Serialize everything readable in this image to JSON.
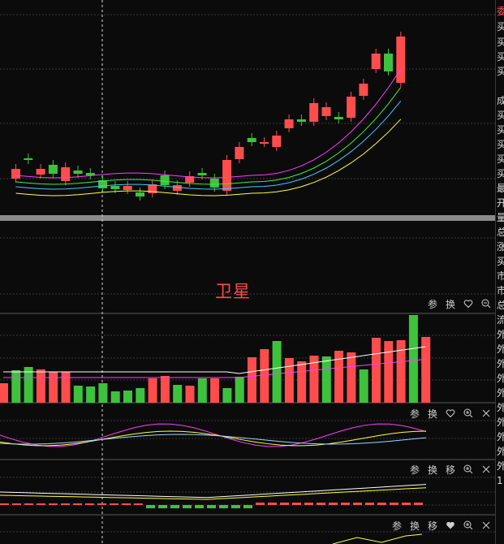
{
  "satellite_label": "卫星",
  "toolbars": [
    {
      "buttons": [
        {
          "name": "param-button",
          "label": "参"
        },
        {
          "name": "switch-button",
          "label": "换"
        },
        {
          "name": "favorite-button",
          "icon": "heart-outline-icon"
        },
        {
          "name": "zoom-out-button",
          "icon": "zoom-out-icon"
        }
      ]
    },
    {
      "buttons": [
        {
          "name": "param-button",
          "label": "参"
        },
        {
          "name": "switch-button",
          "label": "换"
        },
        {
          "name": "favorite-button",
          "icon": "heart-outline-icon"
        },
        {
          "name": "zoom-in-button",
          "icon": "zoom-in-icon"
        },
        {
          "name": "close-button",
          "icon": "close-icon"
        }
      ]
    },
    {
      "buttons": [
        {
          "name": "param-button",
          "label": "参"
        },
        {
          "name": "switch-button",
          "label": "换"
        },
        {
          "name": "move-button",
          "label": "移"
        },
        {
          "name": "zoom-in-button",
          "icon": "zoom-in-icon"
        },
        {
          "name": "close-button",
          "icon": "close-icon"
        }
      ]
    },
    {
      "buttons": [
        {
          "name": "param-button",
          "label": "参"
        },
        {
          "name": "switch-button",
          "label": "换"
        },
        {
          "name": "move-button",
          "label": "移"
        },
        {
          "name": "favorite-button",
          "icon": "heart-filled-icon"
        },
        {
          "name": "zoom-in-button",
          "icon": "zoom-in-icon"
        },
        {
          "name": "close-button",
          "icon": "close-icon"
        }
      ]
    }
  ],
  "right_panel": {
    "chars": [
      "委",
      "买",
      "买",
      "买",
      "买",
      "成",
      "买",
      "买",
      "买",
      "买",
      "买",
      "最",
      "开",
      "量",
      "总",
      "涨",
      "买",
      "市",
      "市",
      "总",
      "流",
      "外",
      "外",
      "外",
      "外",
      "外",
      "外",
      "外",
      "外",
      "外",
      "外",
      "1"
    ]
  },
  "colors": {
    "up": "#ff4d4d",
    "down": "#3ec23e",
    "background": "#0b0b0b",
    "grid": "#3a3a3a",
    "ma5": "#ffffff",
    "ma10": "#ff3cff",
    "ma20": "#3ef03e",
    "ma30": "#40c8ff",
    "ma60": "#ffff40"
  },
  "chart_data": {
    "type": "candlestick",
    "candles": [
      {
        "o": 0,
        "c": 0,
        "h": 0,
        "l": 0,
        "up": true
      },
      {
        "o": 0,
        "c": 0,
        "h": 0,
        "l": 0,
        "up": true
      }
    ],
    "candle_bodies": [
      {
        "up": true,
        "o": 220,
        "c": 208
      },
      {
        "up": false,
        "o": 195,
        "c": 197
      },
      {
        "up": true,
        "o": 215,
        "c": 208
      },
      {
        "up": false,
        "o": 203,
        "c": 214
      },
      {
        "up": true,
        "o": 223,
        "c": 206
      },
      {
        "up": false,
        "o": 210,
        "c": 214
      },
      {
        "up": false,
        "o": 213,
        "c": 216
      },
      {
        "up": false,
        "o": 222,
        "c": 232
      },
      {
        "up": false,
        "o": 229,
        "c": 233
      },
      {
        "up": true,
        "o": 234,
        "c": 229
      },
      {
        "up": false,
        "o": 237,
        "c": 242
      },
      {
        "up": true,
        "o": 238,
        "c": 227
      },
      {
        "up": false,
        "o": 216,
        "c": 228
      },
      {
        "up": true,
        "o": 235,
        "c": 228
      },
      {
        "up": true,
        "o": 225,
        "c": 217
      },
      {
        "up": false,
        "o": 213,
        "c": 216
      },
      {
        "up": false,
        "o": 220,
        "c": 231
      },
      {
        "up": true,
        "o": 235,
        "c": 197
      },
      {
        "up": true,
        "o": 196,
        "c": 181
      },
      {
        "up": false,
        "o": 170,
        "c": 175
      },
      {
        "up": true,
        "o": 176,
        "c": 175
      },
      {
        "up": true,
        "o": 181,
        "c": 167
      },
      {
        "up": true,
        "o": 158,
        "c": 147
      },
      {
        "up": false,
        "o": 147,
        "c": 150
      },
      {
        "up": true,
        "o": 150,
        "c": 127
      },
      {
        "up": true,
        "o": 143,
        "c": 132
      },
      {
        "up": false,
        "o": 144,
        "c": 147
      },
      {
        "up": true,
        "o": 145,
        "c": 119
      },
      {
        "up": true,
        "o": 118,
        "c": 103
      },
      {
        "up": true,
        "o": 85,
        "c": 66
      },
      {
        "up": false,
        "o": 66,
        "c": 88
      },
      {
        "up": true,
        "o": 102,
        "c": 45
      }
    ],
    "volume_bars": [
      {
        "up": true,
        "v": 24
      },
      {
        "up": false,
        "v": 40
      },
      {
        "up": false,
        "v": 44
      },
      {
        "up": true,
        "v": 41
      },
      {
        "up": true,
        "v": 38
      },
      {
        "up": true,
        "v": 38
      },
      {
        "up": false,
        "v": 21
      },
      {
        "up": false,
        "v": 20
      },
      {
        "up": false,
        "v": 24
      },
      {
        "up": false,
        "v": 14
      },
      {
        "up": false,
        "v": 15
      },
      {
        "up": false,
        "v": 18
      },
      {
        "up": true,
        "v": 30
      },
      {
        "up": true,
        "v": 33
      },
      {
        "up": false,
        "v": 22
      },
      {
        "up": true,
        "v": 21
      },
      {
        "up": false,
        "v": 30
      },
      {
        "up": true,
        "v": 30
      },
      {
        "up": false,
        "v": 18
      },
      {
        "up": false,
        "v": 32
      },
      {
        "up": true,
        "v": 56
      },
      {
        "up": true,
        "v": 66
      },
      {
        "up": false,
        "v": 76
      },
      {
        "up": true,
        "v": 55
      },
      {
        "up": true,
        "v": 51
      },
      {
        "up": true,
        "v": 58
      },
      {
        "up": false,
        "v": 57
      },
      {
        "up": true,
        "v": 64
      },
      {
        "up": true,
        "v": 62
      },
      {
        "up": false,
        "v": 41
      },
      {
        "up": true,
        "v": 80
      },
      {
        "up": true,
        "v": 76
      },
      {
        "up": true,
        "v": 77
      },
      {
        "up": false,
        "v": 108
      },
      {
        "up": true,
        "v": 81
      }
    ]
  }
}
